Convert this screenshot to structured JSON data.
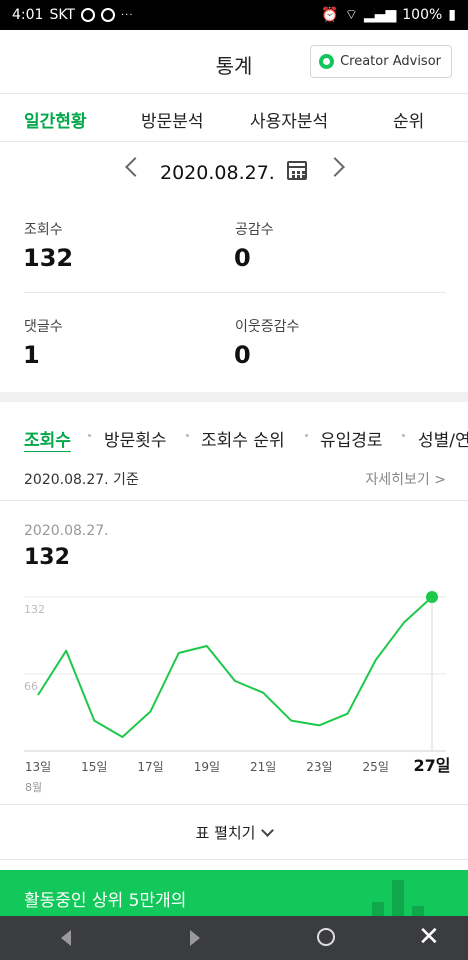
{
  "status_bar": {
    "time": "4:01",
    "carrier": "SKT",
    "battery": "100%"
  },
  "header": {
    "title": "통계",
    "creator_advisor_label": "Creator Advisor"
  },
  "tabs": [
    "일간현황",
    "방문분석",
    "사용자분석",
    "순위"
  ],
  "date_nav": {
    "date": "2020.08.27."
  },
  "stats": [
    {
      "label": "조회수",
      "value": "132"
    },
    {
      "label": "공감수",
      "value": "0"
    },
    {
      "label": "댓글수",
      "value": "1"
    },
    {
      "label": "이웃증감수",
      "value": "0"
    }
  ],
  "sub_tabs": [
    "조회수",
    "방문횟수",
    "조회수 순위",
    "유입경로",
    "성별/연"
  ],
  "section": {
    "ref_date": "2020.08.27. 기준",
    "detail_link": "자세히보기 >"
  },
  "chart_header": {
    "date": "2020.08.27.",
    "value": "132"
  },
  "chart_data": {
    "type": "line",
    "title": "",
    "xlabel": "",
    "ylabel": "",
    "x": [
      "13일",
      "14일",
      "15일",
      "16일",
      "17일",
      "18일",
      "19일",
      "20일",
      "21일",
      "22일",
      "23일",
      "24일",
      "25일",
      "26일",
      "27일"
    ],
    "x_tick_labels": [
      "13일",
      "15일",
      "17일",
      "19일",
      "21일",
      "23일",
      "25일",
      "27일"
    ],
    "x_month_label": "8월",
    "y_tick_labels": [
      "132",
      "66"
    ],
    "ylim": [
      0,
      132
    ],
    "series": [
      {
        "values": [
          48,
          86,
          26,
          12,
          34,
          84,
          90,
          60,
          50,
          26,
          22,
          32,
          78,
          110,
          132
        ]
      }
    ],
    "grid": true,
    "highlight_index": 14,
    "color": "#1ec84a"
  },
  "expand_label": "표 펼치기",
  "banner": {
    "text": "활동중인 상위 5만개의"
  }
}
